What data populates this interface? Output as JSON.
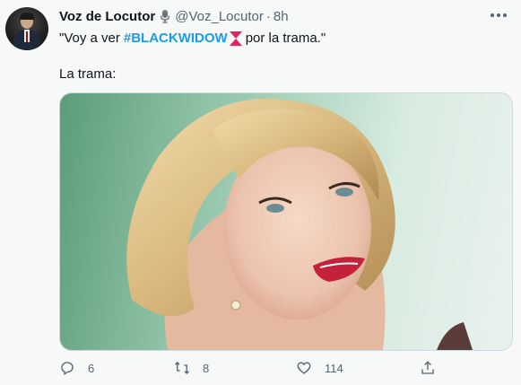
{
  "tweet": {
    "display_name": "Voz de Locutor",
    "handle": "@Voz_Locutor",
    "separator": "·",
    "time": "8h",
    "text_quote_open": "\"Voy a ver",
    "hashtag": "#BLACKWIDOW",
    "text_quote_close": "por la trama.\"",
    "text_line2": "La trama:"
  },
  "actions": {
    "reply_count": "6",
    "retweet_count": "8",
    "like_count": "114"
  },
  "icons": {
    "verified_mic": "microphone-icon",
    "black_widow": "hourglass-icon",
    "more": "more-icon",
    "reply": "reply-icon",
    "retweet": "retweet-icon",
    "like": "like-icon",
    "share": "share-icon"
  },
  "colors": {
    "accent": "#1d9bf0",
    "muted": "#536471",
    "black_widow_red": "#e0245e",
    "background": "#f7f9f9"
  }
}
